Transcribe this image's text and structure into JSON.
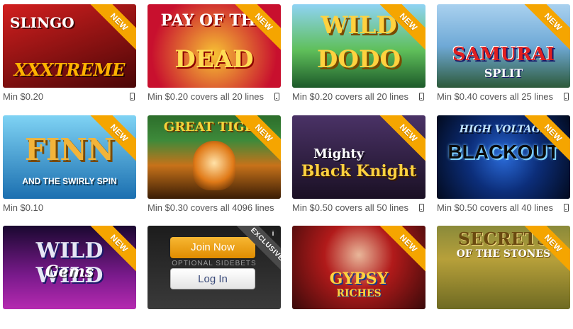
{
  "badges": {
    "new": "NEW",
    "exclusive": "EXCLUSIVE"
  },
  "games": [
    {
      "title_line1": "SLINGO",
      "title_line2": "XXXTREME",
      "caption": "Min $0.20",
      "colors": [
        "#b3161b",
        "#2a0505"
      ]
    },
    {
      "title_line1": "PAY OF THE",
      "title_line2": "DEAD",
      "caption": "Min $0.20 covers all 20 lines",
      "colors": [
        "#c8102e",
        "#f7c234"
      ]
    },
    {
      "title_line1": "WILD",
      "title_line2": "DODO",
      "caption": "Min $0.20 covers all 20 lines",
      "colors": [
        "#3aa54a",
        "#1d5a2a"
      ]
    },
    {
      "title_line1": "SAMURAI",
      "title_line2": "SPLIT",
      "caption": "Min $0.40 covers all 25 lines",
      "colors": [
        "#6fa9d6",
        "#2d2d7a"
      ]
    },
    {
      "title_line1": "FINN",
      "title_line2": "AND THE SWIRLY SPIN",
      "caption": "Min $0.10",
      "colors": [
        "#39b5e6",
        "#1b6fb0"
      ]
    },
    {
      "title_line1": "GREAT TIGER",
      "title_line2": "",
      "caption": "Min $0.30 covers all 4096 lines",
      "colors": [
        "#2c6e2b",
        "#d77a1c"
      ]
    },
    {
      "title_line1": "Mighty",
      "title_line2": "Black Knight",
      "caption": "Min $0.50 covers all 50 lines",
      "colors": [
        "#3d2752",
        "#1a1024"
      ]
    },
    {
      "title_line1": "HIGH VOLTAGE",
      "title_line2": "BLACKOUT",
      "caption": "Min $0.50 covers all 40 lines",
      "colors": [
        "#0c2e7a",
        "#020a1e"
      ]
    },
    {
      "title_line1": "WILD WILD",
      "title_line2": "Gems",
      "caption": "",
      "colors": [
        "#7a1a8c",
        "#1a0830"
      ]
    },
    {
      "title_line1": "",
      "title_line2": "",
      "caption": "",
      "colors": [
        "#1c1c1c",
        "#3a3a3a"
      ]
    },
    {
      "title_line1": "GYPSY",
      "title_line2": "RICHES",
      "caption": "",
      "colors": [
        "#b11a1a",
        "#3a0a0a"
      ]
    },
    {
      "title_line1": "SECRETS",
      "title_line2": "OF THE STONES",
      "caption": "",
      "colors": [
        "#b7a03a",
        "#6e6a22"
      ]
    }
  ],
  "promo": {
    "join_label": "Join Now",
    "login_label": "Log In",
    "sub_text": "OPTIONAL SIDEBETS",
    "info_glyph": "i"
  },
  "icons": {
    "mobile": "mobile-device-icon",
    "info": "info-icon"
  }
}
